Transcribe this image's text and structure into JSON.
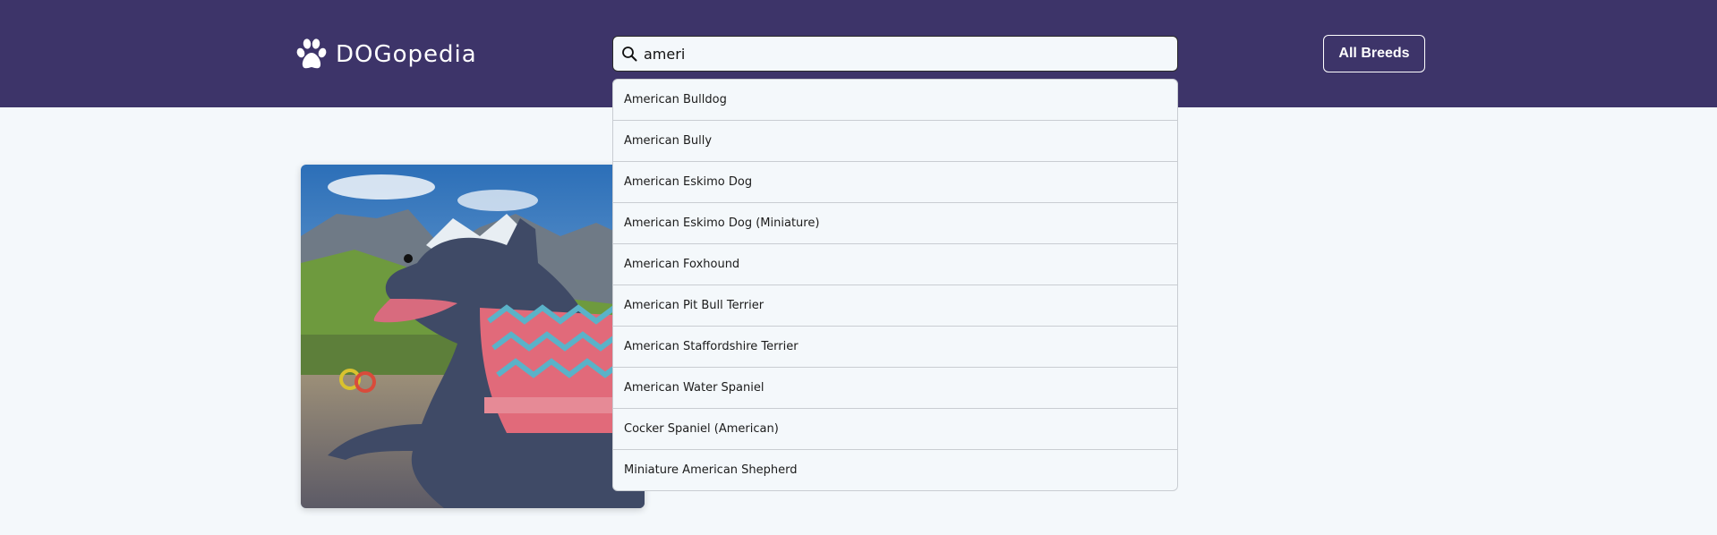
{
  "header": {
    "brand": "DOGopedia",
    "logo_icon": "paw-icon",
    "background_color": "#3d3469"
  },
  "search": {
    "icon": "search-icon",
    "value": "ameri",
    "suggestions": [
      "American Bulldog",
      "American Bully",
      "American Eskimo Dog",
      "American Eskimo Dog (Miniature)",
      "American Foxhound",
      "American Pit Bull Terrier",
      "American Staffordshire Terrier",
      "American Water Spaniel",
      "Cocker Spaniel (American)",
      "Miniature American Shepherd"
    ]
  },
  "nav": {
    "all_breeds_label": "All Breeds"
  },
  "main": {
    "image": "dog-photo"
  }
}
